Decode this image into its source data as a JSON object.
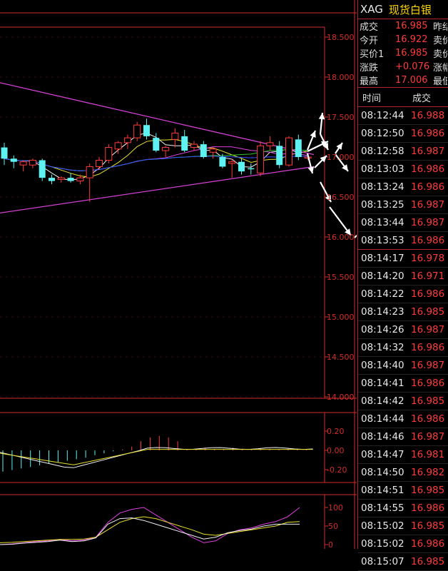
{
  "quote": {
    "code": "XAG",
    "name": "现货白银",
    "rows": [
      {
        "label": "成交",
        "value": "16.985",
        "right": "昨结"
      },
      {
        "label": "今开",
        "value": "16.922",
        "right": "卖价"
      },
      {
        "label": "买价1",
        "value": "16.985",
        "right": "卖价"
      },
      {
        "label": "涨跌",
        "value": "+0.076",
        "right": "涨幅"
      },
      {
        "label": "最高",
        "value": "17.006",
        "right": "最低"
      }
    ]
  },
  "ticks": {
    "header_time": "时间",
    "header_price": "成交",
    "rows": [
      {
        "time": "08:12:44",
        "price": "16.988"
      },
      {
        "time": "08:12:50",
        "price": "16.986"
      },
      {
        "time": "08:12:58",
        "price": "16.987"
      },
      {
        "time": "08:13:03",
        "price": "16.986"
      },
      {
        "time": "08:13:24",
        "price": "16.986"
      },
      {
        "time": "08:13:25",
        "price": "16.987"
      },
      {
        "time": "08:13:44",
        "price": "16.987"
      },
      {
        "time": "08:13:53",
        "price": "16.986"
      },
      {
        "time": "08:14:17",
        "price": "16.978"
      },
      {
        "time": "08:14:20",
        "price": "16.971"
      },
      {
        "time": "08:14:22",
        "price": "16.986"
      },
      {
        "time": "08:14:23",
        "price": "16.985"
      },
      {
        "time": "08:14:26",
        "price": "16.987"
      },
      {
        "time": "08:14:32",
        "price": "16.986"
      },
      {
        "time": "08:14:40",
        "price": "16.987"
      },
      {
        "time": "08:14:41",
        "price": "16.986"
      },
      {
        "time": "08:14:42",
        "price": "16.985"
      },
      {
        "time": "08:14:44",
        "price": "16.986"
      },
      {
        "time": "08:14:46",
        "price": "16.987"
      },
      {
        "time": "08:14:47",
        "price": "16.981"
      },
      {
        "time": "08:14:50",
        "price": "16.982"
      },
      {
        "time": "08:14:51",
        "price": "16.985"
      },
      {
        "time": "08:14:55",
        "price": "16.986"
      },
      {
        "time": "08:15:02",
        "price": "16.985"
      },
      {
        "time": "08:15:02",
        "price": "16.986"
      },
      {
        "time": "08:15:07",
        "price": "16.985"
      }
    ]
  },
  "chart_data": [
    {
      "type": "candlestick",
      "y_ticks": [
        "18.500",
        "18.000",
        "17.500",
        "17.000",
        "16.500",
        "16.000",
        "15.500",
        "15.000",
        "14.500",
        "14.000"
      ],
      "ylim": [
        14.0,
        18.6
      ],
      "candles": [
        {
          "o": 17.12,
          "h": 17.18,
          "l": 16.9,
          "c": 16.98,
          "color": "cyan"
        },
        {
          "o": 16.98,
          "h": 17.02,
          "l": 16.86,
          "c": 16.94,
          "color": "cyan"
        },
        {
          "o": 16.9,
          "h": 16.96,
          "l": 16.82,
          "c": 16.94,
          "color": "red"
        },
        {
          "o": 16.9,
          "h": 16.98,
          "l": 16.86,
          "c": 16.96,
          "color": "red"
        },
        {
          "o": 16.96,
          "h": 16.98,
          "l": 16.7,
          "c": 16.74,
          "color": "cyan"
        },
        {
          "o": 16.74,
          "h": 16.78,
          "l": 16.66,
          "c": 16.7,
          "color": "cyan"
        },
        {
          "o": 16.72,
          "h": 16.76,
          "l": 16.68,
          "c": 16.74,
          "color": "red"
        },
        {
          "o": 16.74,
          "h": 16.8,
          "l": 16.68,
          "c": 16.7,
          "color": "cyan"
        },
        {
          "o": 16.7,
          "h": 16.78,
          "l": 16.66,
          "c": 16.74,
          "color": "red"
        },
        {
          "o": 16.74,
          "h": 16.92,
          "l": 16.44,
          "c": 16.88,
          "color": "red"
        },
        {
          "o": 16.88,
          "h": 17.0,
          "l": 16.84,
          "c": 16.96,
          "color": "red"
        },
        {
          "o": 16.96,
          "h": 17.16,
          "l": 16.92,
          "c": 17.12,
          "color": "red"
        },
        {
          "o": 17.1,
          "h": 17.2,
          "l": 17.04,
          "c": 17.18,
          "color": "red"
        },
        {
          "o": 17.18,
          "h": 17.28,
          "l": 17.1,
          "c": 17.24,
          "color": "red"
        },
        {
          "o": 17.24,
          "h": 17.44,
          "l": 17.2,
          "c": 17.4,
          "color": "red"
        },
        {
          "o": 17.4,
          "h": 17.48,
          "l": 17.22,
          "c": 17.26,
          "color": "cyan"
        },
        {
          "o": 17.24,
          "h": 17.3,
          "l": 17.06,
          "c": 17.08,
          "color": "cyan"
        },
        {
          "o": 17.08,
          "h": 17.14,
          "l": 17.0,
          "c": 17.12,
          "color": "red"
        },
        {
          "o": 17.3,
          "h": 17.36,
          "l": 17.12,
          "c": 17.22,
          "color": "red"
        },
        {
          "o": 17.26,
          "h": 17.34,
          "l": 17.06,
          "c": 17.08,
          "color": "cyan"
        },
        {
          "o": 17.12,
          "h": 17.2,
          "l": 17.08,
          "c": 17.16,
          "color": "red"
        },
        {
          "o": 17.16,
          "h": 17.2,
          "l": 16.98,
          "c": 17.0,
          "color": "cyan"
        },
        {
          "o": 17.06,
          "h": 17.12,
          "l": 16.98,
          "c": 17.1,
          "color": "red"
        },
        {
          "o": 17.0,
          "h": 17.04,
          "l": 16.86,
          "c": 16.88,
          "color": "cyan"
        },
        {
          "o": 16.92,
          "h": 16.98,
          "l": 16.74,
          "c": 16.94,
          "color": "red"
        },
        {
          "o": 16.94,
          "h": 16.98,
          "l": 16.78,
          "c": 16.82,
          "color": "cyan"
        },
        {
          "o": 16.86,
          "h": 16.92,
          "l": 16.78,
          "c": 16.86,
          "color": "cyan"
        },
        {
          "o": 16.8,
          "h": 17.2,
          "l": 16.76,
          "c": 17.14,
          "color": "red"
        },
        {
          "o": 17.14,
          "h": 17.26,
          "l": 17.08,
          "c": 17.18,
          "color": "red"
        },
        {
          "o": 17.14,
          "h": 17.2,
          "l": 16.86,
          "c": 16.9,
          "color": "cyan"
        },
        {
          "o": 16.9,
          "h": 17.26,
          "l": 16.88,
          "c": 17.24,
          "color": "red"
        },
        {
          "o": 17.22,
          "h": 17.28,
          "l": 16.96,
          "c": 17.0,
          "color": "cyan"
        },
        {
          "o": 17.0,
          "h": 17.04,
          "l": 16.96,
          "c": 16.99,
          "color": "red"
        }
      ]
    },
    {
      "type": "bar",
      "y_ticks": [
        "0.20",
        "0.00",
        "-0.20"
      ],
      "ylim": [
        -0.3,
        0.3
      ]
    },
    {
      "type": "line",
      "y_ticks": [
        "100",
        "50",
        "0"
      ],
      "ylim": [
        0,
        120
      ]
    }
  ]
}
